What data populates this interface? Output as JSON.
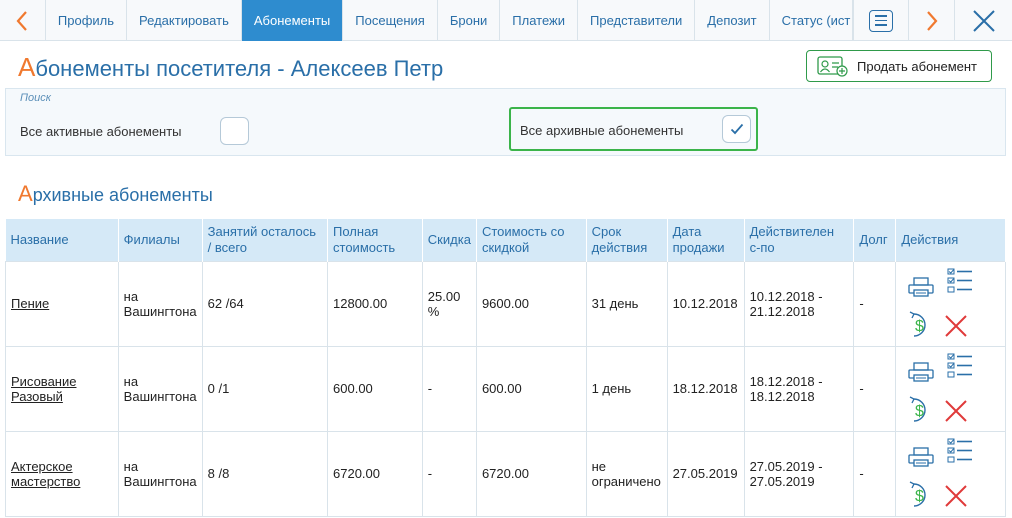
{
  "tabs": {
    "items": [
      {
        "label": "Профиль",
        "active": false
      },
      {
        "label": "Редактировать",
        "active": false
      },
      {
        "label": "Абонементы",
        "active": true
      },
      {
        "label": "Посещения",
        "active": false
      },
      {
        "label": "Брони",
        "active": false
      },
      {
        "label": "Платежи",
        "active": false
      },
      {
        "label": "Представители",
        "active": false
      },
      {
        "label": "Депозит",
        "active": false
      },
      {
        "label": "Статус (ист",
        "active": false
      }
    ]
  },
  "header": {
    "title_first": "А",
    "title_rest": "бонементы посетителя - Алексеев Петр",
    "sell_button": "Продать абонемент"
  },
  "search": {
    "caption": "Поиск",
    "active_label": "Все активные абонементы",
    "active_checked": false,
    "archive_label": "Все архивные абонементы",
    "archive_checked": true
  },
  "section": {
    "title_first": "А",
    "title_rest": "рхивные абонементы"
  },
  "table": {
    "headers": [
      "Название",
      "Филиалы",
      "Занятий осталось / всего",
      "Полная стоимость",
      "Скидка",
      "Стоимость со скидкой",
      "Срок действия",
      "Дата продажи",
      "Действителен с-по",
      "Долг",
      "Действия"
    ],
    "rows": [
      {
        "name": "Пение",
        "branch": "на Вашингтона",
        "lessons": "62 /64",
        "full_price": "12800.00",
        "discount": "25.00 %",
        "discounted_price": "9600.00",
        "term": "31 день",
        "sale_date": "10.12.2018",
        "valid": "10.12.2018 - 21.12.2018",
        "debt": "-"
      },
      {
        "name": "Рисование Разовый",
        "branch": "на Вашингтона",
        "lessons": "0 /1",
        "full_price": "600.00",
        "discount": "-",
        "discounted_price": "600.00",
        "term": "1 день",
        "sale_date": "18.12.2018",
        "valid": "18.12.2018 - 18.12.2018",
        "debt": "-"
      },
      {
        "name": "Актерское мастерство",
        "branch": "на Вашингтона",
        "lessons": "8 /8",
        "full_price": "6720.00",
        "discount": "-",
        "discounted_price": "6720.00",
        "term": "не ограничено",
        "sale_date": "27.05.2019",
        "valid": "27.05.2019 - 27.05.2019",
        "debt": "-"
      }
    ]
  },
  "colors": {
    "accent": "#2a6fa8",
    "active_tab": "#2e8ccf",
    "orange": "#f0792f",
    "green": "#3bb44a",
    "red": "#e03a3a"
  },
  "icons": {
    "prev": "chevron-left-icon",
    "next": "chevron-right-icon",
    "menu": "menu-icon",
    "close": "close-icon",
    "sell": "add-user-card-icon",
    "print": "print-icon",
    "details": "checklist-icon",
    "refund": "refund-dollar-icon",
    "delete": "delete-x-icon"
  }
}
